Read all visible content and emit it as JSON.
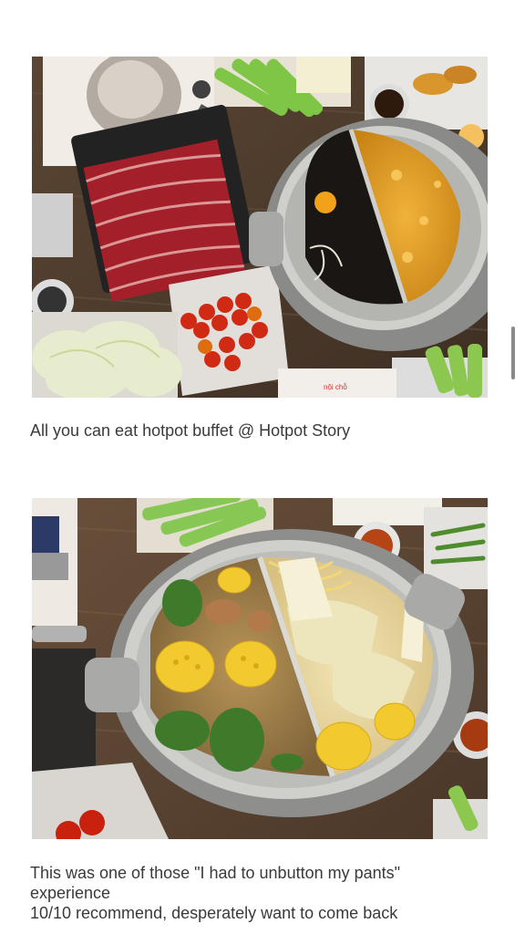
{
  "post": {
    "images": [
      {
        "alt": "All you can eat hotpot buffet @ Hotpot Story"
      },
      {
        "alt": "This was one of those \"I had to unbutton my pants\" experience 10/10 recommend, desperately want to come back"
      }
    ],
    "caption_1": "All you can eat hotpot buffet @ Hotpot Story",
    "caption_2": {
      "line_1": "This was one of those \"I had to unbutton my pants\"",
      "line_2": "experience",
      "line_3": "10/10 recommend, desperately want to come back"
    }
  },
  "colors": {
    "background": "#ffffff",
    "text": "#3a3a3a",
    "scrollbar": "#8a8a8a"
  }
}
